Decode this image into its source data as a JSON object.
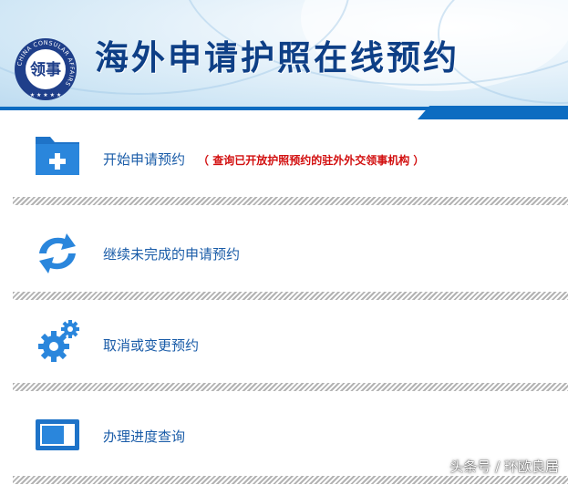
{
  "header": {
    "title": "海外申请护照在线预约",
    "logo_text": "CHINA CONSULAR AFFAIRS",
    "logo_glyphs": "领事"
  },
  "menu": [
    {
      "label": "开始申请预约",
      "note": "（ 查询已开放护照预约的驻外外交领事机构 ）",
      "icon": "folder-plus-icon"
    },
    {
      "label": "继续未完成的申请预约",
      "icon": "refresh-icon"
    },
    {
      "label": "取消或变更预约",
      "icon": "gears-icon"
    },
    {
      "label": "办理进度查询",
      "icon": "progress-icon"
    }
  ],
  "watermark": "头条号 / 环欧良居",
  "colors": {
    "primary": "#0c6cc1",
    "title": "#0e3f86",
    "link": "#1a5ca8",
    "note": "#d20f0f"
  }
}
